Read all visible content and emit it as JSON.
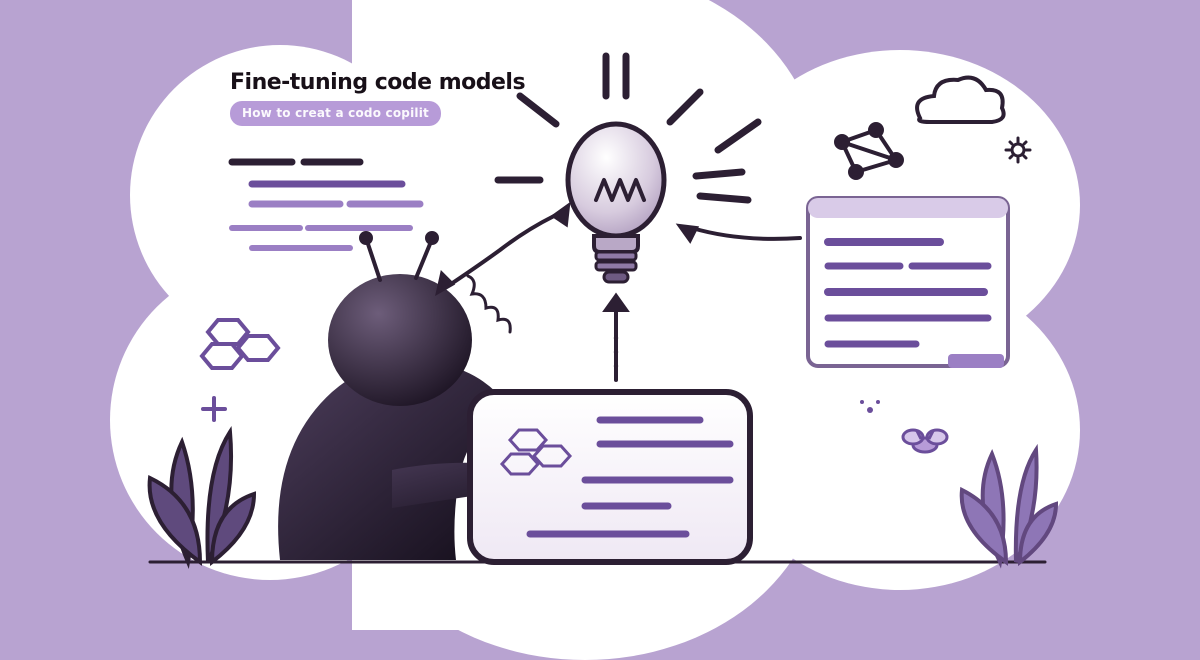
{
  "colors": {
    "bg": "#b8a3d1",
    "white": "#ffffff",
    "ink": "#2c1f33",
    "accent": "#6b4e9b",
    "accent_light": "#9b7fc4",
    "pill": "#b79bd8"
  },
  "title": "Fine-tuning code models",
  "subtitle": "How to creat a codo copilit",
  "icons": {
    "bulb": "lightbulb-icon",
    "cloud_small": "cloud-icon",
    "gear": "gear-icon",
    "molecule1": "molecule-icon",
    "molecule2": "molecule-icon",
    "plus": "plus-icon",
    "bee": "bee-icon"
  }
}
